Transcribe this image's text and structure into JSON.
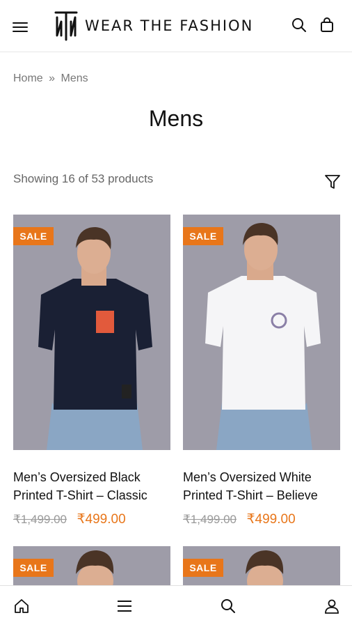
{
  "header": {
    "brand": "WEAR THE FASHION",
    "menu_icon": "hamburger-menu-icon",
    "search_icon": "search-icon",
    "cart_icon": "shopping-bag-icon"
  },
  "breadcrumb": {
    "home": "Home",
    "separator": "»",
    "current": "Mens"
  },
  "page": {
    "title": "Mens",
    "result_count": "Showing 16 of 53 products",
    "filter_icon": "filter-icon"
  },
  "products": [
    {
      "badge": "SALE",
      "name": "Men’s Oversized Black Printed T-Shirt – Classic",
      "old_price": "₹1,499.00",
      "price": "₹499.00",
      "shirt_color": "#1a2034"
    },
    {
      "badge": "SALE",
      "name": "Men’s Oversized White Printed T-Shirt – Believe",
      "old_price": "₹1,499.00",
      "price": "₹499.00",
      "shirt_color": "#f5f5f7"
    },
    {
      "badge": "SALE"
    },
    {
      "badge": "SALE"
    }
  ],
  "colors": {
    "accent": "#e8761a",
    "image_bg": "#9e9ca8"
  },
  "bottom_nav": [
    "home-icon",
    "menu-icon",
    "search-icon",
    "account-icon"
  ]
}
